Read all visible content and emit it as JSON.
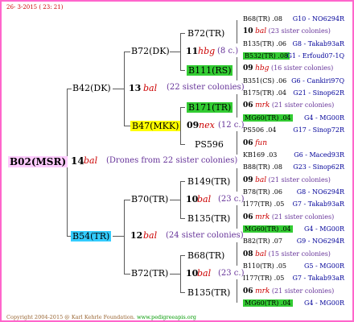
{
  "header": {
    "date_line": "26-  3-2015 ( 23: 21)"
  },
  "footer": {
    "copyright": "Copyright 2004-2015 @ Karl Kehrle Foundation.",
    "site": "www.pedigreeapis.org"
  },
  "colors": {
    "border": "#ff66cc",
    "pink_hl": "#ffccff",
    "yellow_hl": "#ffff00",
    "cyan_hl": "#33ccff",
    "green_hl": "#33cc33"
  },
  "root": {
    "label": "B02(MSR)",
    "gen": "14",
    "mark": "bal",
    "note": "(Drones from 22 sister colonies)"
  },
  "lvl1": [
    {
      "label": "B42(DK)",
      "gen": "13",
      "mark": "bal",
      "note": "(22 sister colonies)"
    },
    {
      "label": "B54(TR)",
      "gen": "12",
      "mark": "bal",
      "note": "(24 sister colonies)"
    }
  ],
  "lvl2": [
    {
      "label": "B72(DK)",
      "gen": "11",
      "mark": "hbg",
      "note": "(8 c.)"
    },
    {
      "label": "B47(MKK)",
      "gen": "09",
      "mark": "nex",
      "note": "(12 c.)"
    },
    {
      "label": "B70(TR)",
      "gen": "10",
      "mark": "bal",
      "note": "(23 c.)"
    },
    {
      "label": "B72(TR)",
      "gen": "10",
      "mark": "bal",
      "note": "(23 c.)"
    }
  ],
  "lvl3": [
    {
      "label": "B72(TR)"
    },
    {
      "label": "B111(RS)"
    },
    {
      "label": "B171(TR)"
    },
    {
      "label": "PS596"
    },
    {
      "label": "B149(TR)"
    },
    {
      "label": "B135(TR)"
    },
    {
      "label": "B68(TR)"
    },
    {
      "label": "B135(TR)"
    }
  ],
  "right": [
    {
      "a": "B68(TR) .08",
      "b": "G10 - NO6294R"
    },
    {
      "a": "10",
      "mark": "bal",
      "note": "(23 sister colonies)"
    },
    {
      "a": "B135(TR) .06",
      "b": "G8 - Takab93aR"
    },
    {
      "a": "B532(TR) .08",
      "b": "G1 - Erfoud07-1Q"
    },
    {
      "a": "09",
      "mark": "hbg",
      "note": "(16 sister colonies)"
    },
    {
      "a": "B351(CS) .06",
      "b": "G6 - Cankiri97Q"
    },
    {
      "a": "B175(TR) .04",
      "b": "G21 - Sinop62R"
    },
    {
      "a": "06",
      "mark": "mrk",
      "note": "(21 sister colonies)"
    },
    {
      "a": "MG60(TR) .04",
      "b": "G4 - MG00R"
    },
    {
      "a": "PS506 .04",
      "b": "G17 - Sinop72R"
    },
    {
      "a": "06",
      "mark": "fun",
      "note": ""
    },
    {
      "a": "KB169 .03",
      "b": "G6 - Maced93R"
    },
    {
      "a": "B88(TR) .08",
      "b": "G23 - Sinop62R"
    },
    {
      "a": "09",
      "mark": "bal",
      "note": "(21 sister colonies)"
    },
    {
      "a": "B78(TR) .06",
      "b": "G8 - NO6294R"
    },
    {
      "a": "I177(TR) .05",
      "b": "G7 - Takab93aR"
    },
    {
      "a": "06",
      "mark": "mrk",
      "note": "(21 sister colonies)"
    },
    {
      "a": "MG60(TR) .04",
      "b": "G4 - MG00R"
    },
    {
      "a": "B82(TR) .07",
      "b": "G9 - NO6294R"
    },
    {
      "a": "08",
      "mark": "bal",
      "note": "(15 sister colonies)"
    },
    {
      "a": "B110(TR) .05",
      "b": "G5 - MG00R"
    },
    {
      "a": "I177(TR) .05",
      "b": "G7 - Takab93aR"
    },
    {
      "a": "06",
      "mark": "mrk",
      "note": "(21 sister colonies)"
    },
    {
      "a": "MG60(TR) .04",
      "b": "G4 - MG00R"
    }
  ]
}
